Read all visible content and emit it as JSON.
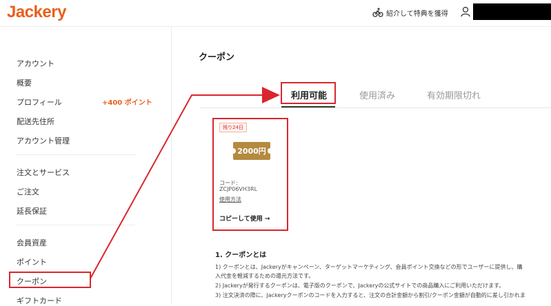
{
  "header": {
    "logo": "Jackery",
    "referral_label": "紹介して特典を獲得",
    "icons": [
      "referral-bike-icon",
      "user-icon"
    ]
  },
  "sidebar": {
    "account_heading": "アカウント",
    "overview": "概要",
    "profile": "プロフィール",
    "profile_points": "+400 ポイント",
    "shipping": "配送先住所",
    "account_management": "アカウント管理",
    "orders_heading": "注文とサービス",
    "orders": "ご注文",
    "warranty": "延長保証",
    "assets_heading": "会員資産",
    "points": "ポイント",
    "coupon": "クーポン",
    "gift_card": "ギフトカード"
  },
  "main": {
    "title": "クーポン",
    "tabs": [
      {
        "label": "利用可能",
        "active": true
      },
      {
        "label": "使用済み",
        "active": false
      },
      {
        "label": "有効期限切れ",
        "active": false
      }
    ],
    "coupon": {
      "badge": "残り24日",
      "amount": "2000円",
      "code_label": "コード:",
      "code": "ZCJP06VH3RL",
      "how_to": "使用方法",
      "copy": "コピーして使用 →"
    },
    "info": {
      "title": "1. クーポンとは",
      "paragraphs": [
        "1) クーポンとは、Jackeryがキャンペーン、ターゲットマーケティング、会員ポイント交換などの形でユーザーに提供し、購",
        "入代金を軽減するための還元方法です。",
        "2) Jackeryが発行するクーポンは、電子版のクーポンで、Jackeryの公式サイトでの商品購入にご利用いただけます。",
        "3) 注文決済の際に、Jackeryクーポンのコードを入力すると、注文の合計金額から割引/クーポン金額が自動的に差し引かれま"
      ]
    }
  },
  "colors": {
    "brand": "#e8601c",
    "annotation_red": "#d9262c",
    "coupon_gold": "#b48a3f",
    "active_tab_underline": "#2b3a2a"
  }
}
